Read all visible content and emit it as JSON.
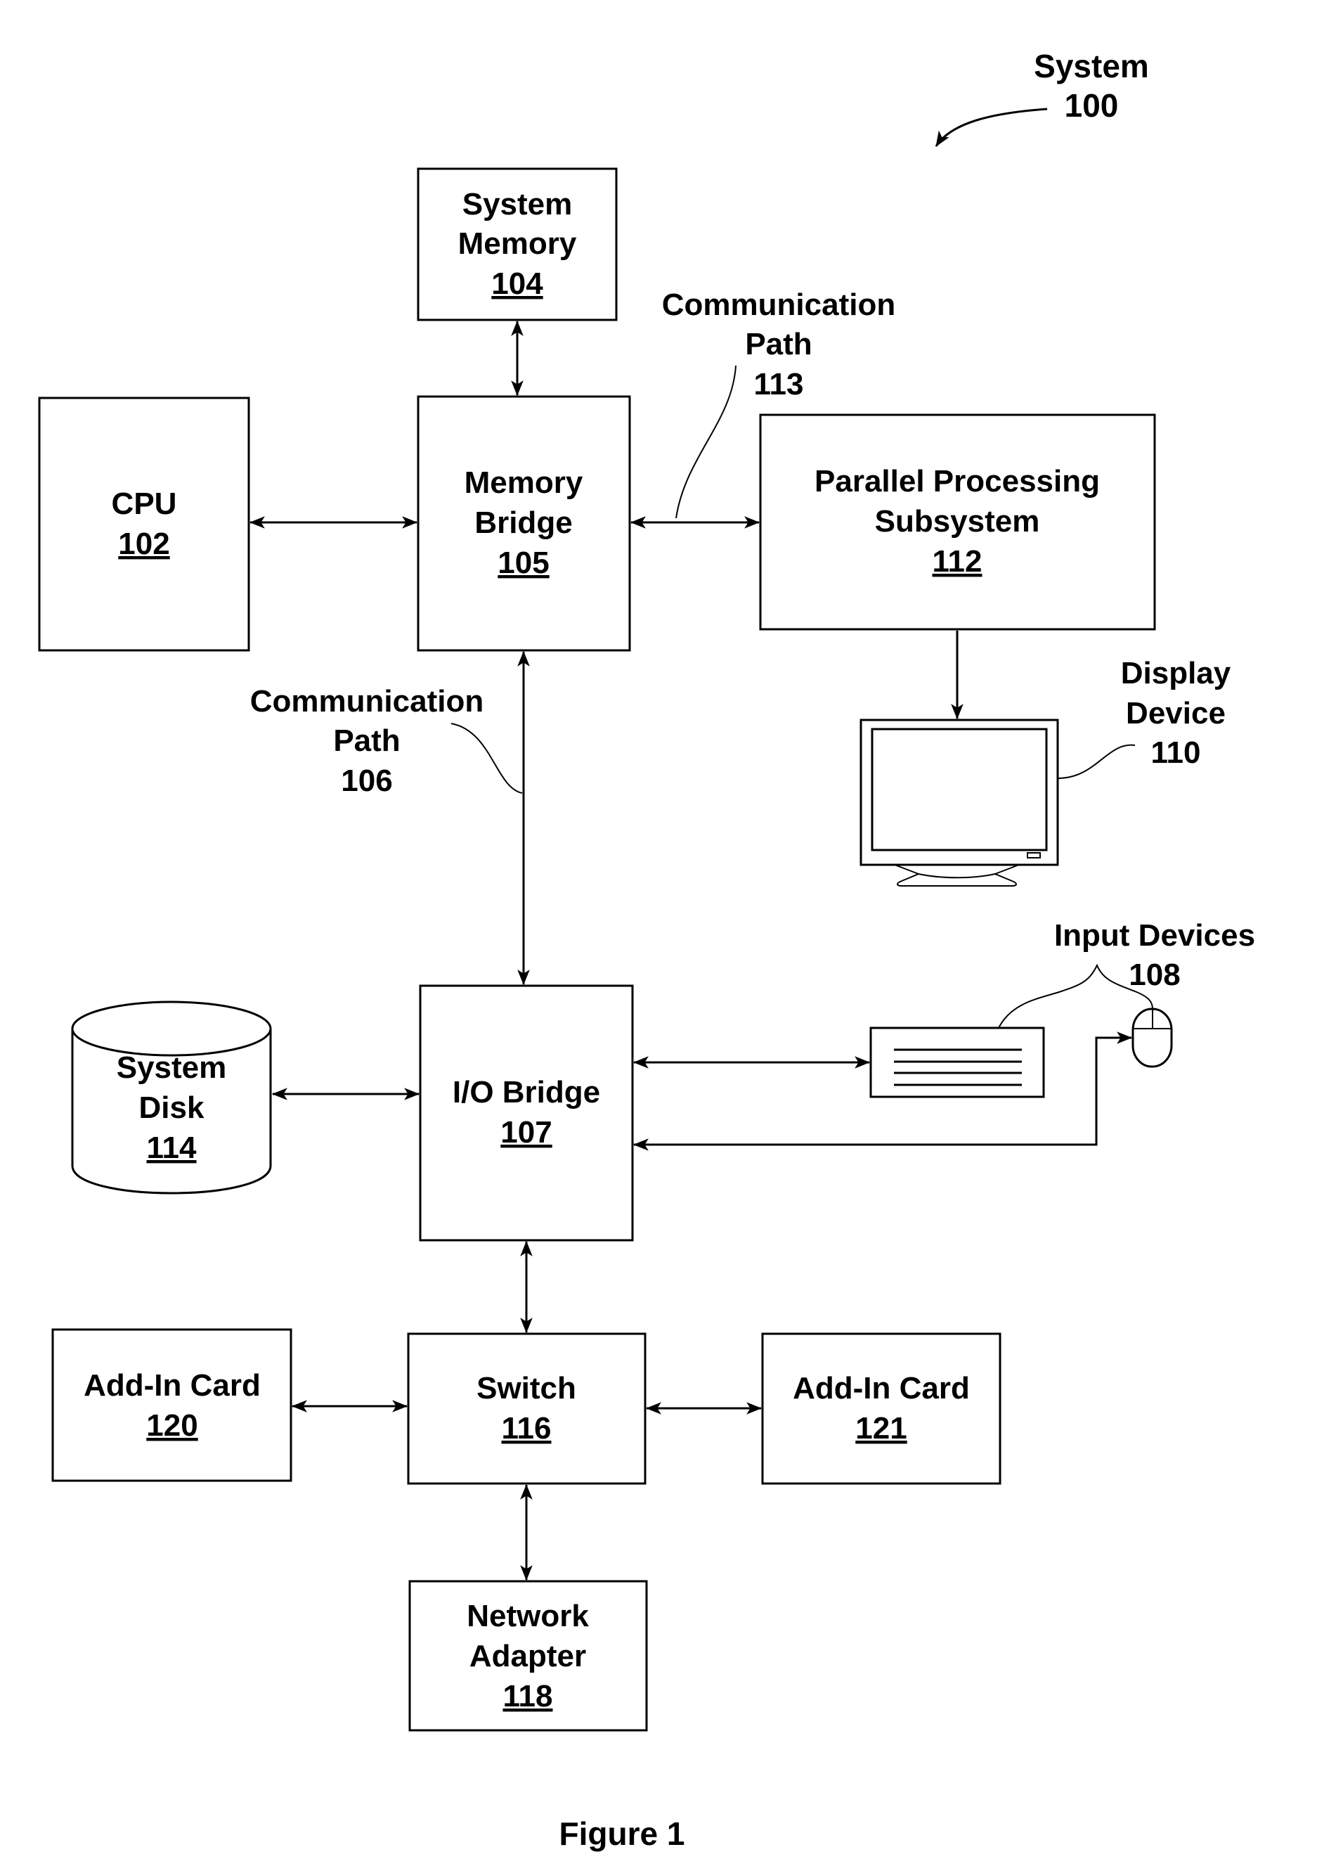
{
  "figure": {
    "caption": "Figure 1",
    "system_label": {
      "name": "System",
      "ref": "100"
    }
  },
  "components": {
    "system_memory": {
      "lines": [
        "System",
        "Memory"
      ],
      "ref": "104"
    },
    "cpu": {
      "lines": [
        "CPU"
      ],
      "ref": "102"
    },
    "memory_bridge": {
      "lines": [
        "Memory",
        "Bridge"
      ],
      "ref": "105"
    },
    "parallel_processing": {
      "lines": [
        "Parallel Processing",
        "Subsystem"
      ],
      "ref": "112"
    },
    "io_bridge": {
      "lines": [
        "I/O Bridge"
      ],
      "ref": "107"
    },
    "system_disk": {
      "lines": [
        "System",
        "Disk"
      ],
      "ref": "114"
    },
    "switch": {
      "lines": [
        "Switch"
      ],
      "ref": "116"
    },
    "add_in_card_120": {
      "lines": [
        "Add-In Card"
      ],
      "ref": "120"
    },
    "add_in_card_121": {
      "lines": [
        "Add-In Card"
      ],
      "ref": "121"
    },
    "network_adapter": {
      "lines": [
        "Network",
        "Adapter"
      ],
      "ref": "118"
    }
  },
  "callouts": {
    "comm_path_113": {
      "lines": [
        "Communication",
        "Path"
      ],
      "ref": "113"
    },
    "comm_path_106": {
      "lines": [
        "Communication",
        "Path"
      ],
      "ref": "106"
    },
    "display_device": {
      "lines": [
        "Display",
        "Device"
      ],
      "ref": "110"
    },
    "input_devices": {
      "lines": [
        "Input Devices"
      ],
      "ref": "108"
    }
  },
  "icons": {
    "display": "monitor-icon",
    "keyboard": "keyboard-icon",
    "mouse": "mouse-icon",
    "disk": "cylinder-disk-icon"
  }
}
